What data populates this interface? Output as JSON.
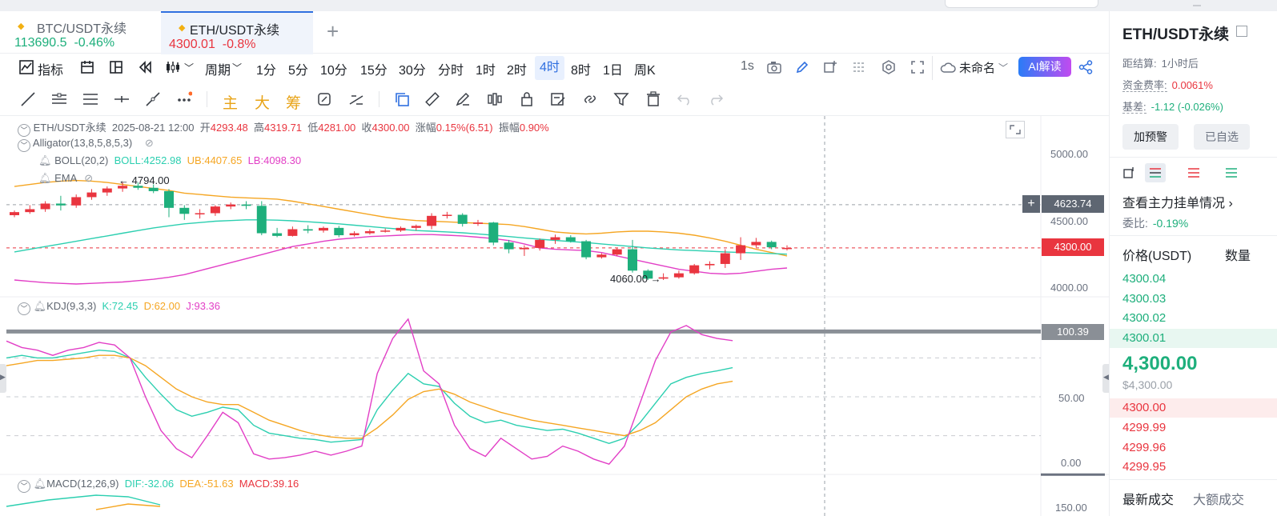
{
  "tabs": [
    {
      "symbol": "BTC/USDT永续",
      "price": "113690.5",
      "change": "-0.46%"
    },
    {
      "symbol": "ETH/USDT永续",
      "price": "4300.01",
      "change": "-0.8%"
    }
  ],
  "toolbar": {
    "indicators": "指标",
    "period": "周期",
    "intervals": [
      "1分",
      "5分",
      "10分",
      "15分",
      "30分",
      "分时",
      "1时",
      "2时",
      "4时",
      "8时",
      "1日",
      "周K"
    ],
    "selected_interval": "4时",
    "refresh": "1s",
    "layout_name": "未命名",
    "ai": "AI解读"
  },
  "drawing_tools": {
    "main": "主",
    "big": "大",
    "chips": "筹"
  },
  "legend": {
    "symbol": "ETH/USDT永续",
    "time": "2025-08-21 12:00",
    "open_label": "开",
    "open": "4293.48",
    "high_label": "高",
    "high": "4319.71",
    "low_label": "低",
    "low": "4281.00",
    "close_label": "收",
    "close": "4300.00",
    "change_label": "涨幅",
    "change": "0.15%(6.51)",
    "amp_label": "振幅",
    "amp": "0.90%",
    "alligator": "Alligator(13,8,5,8,5,3)",
    "boll": "BOLL(20,2)",
    "boll_mid": "BOLL:4252.98",
    "boll_ub": "UB:4407.65",
    "boll_lb": "LB:4098.30",
    "ema": "EMA",
    "kdj": "KDJ(9,3,3)",
    "kdj_k": "K:72.45",
    "kdj_d": "D:62.00",
    "kdj_j": "J:93.36",
    "macd": "MACD(12,26,9)",
    "macd_dif": "DIF:-32.06",
    "macd_dea": "DEA:-51.63",
    "macd_val": "MACD:39.16"
  },
  "price_axis": {
    "ticks": [
      "5000.00",
      "4500.00",
      "4000.00"
    ],
    "crosshair": "4623.74",
    "last": "4300.00",
    "high_marker": "4794.00",
    "low_marker": "4060.00"
  },
  "kdj_axis": {
    "ticks": [
      "50.00",
      "0.00"
    ],
    "crosshair": "100.39"
  },
  "macd_axis": {
    "ticks": [
      "150.00"
    ]
  },
  "colors": {
    "up": "#1eaf7c",
    "down": "#e9353f",
    "accent": "#3070e0",
    "ub": "#f5a623",
    "mid": "#2ccfb0",
    "lb": "#e23fc6"
  },
  "chart_data": {
    "type": "candlestick",
    "title": "ETH/USDT永续",
    "interval": "4时",
    "candles": [
      {
        "o": 4545,
        "h": 4580,
        "l": 4530,
        "c": 4568
      },
      {
        "o": 4568,
        "h": 4620,
        "l": 4555,
        "c": 4590
      },
      {
        "o": 4590,
        "h": 4650,
        "l": 4570,
        "c": 4632
      },
      {
        "o": 4632,
        "h": 4690,
        "l": 4580,
        "c": 4618
      },
      {
        "o": 4618,
        "h": 4700,
        "l": 4600,
        "c": 4680
      },
      {
        "o": 4680,
        "h": 4740,
        "l": 4660,
        "c": 4715
      },
      {
        "o": 4715,
        "h": 4760,
        "l": 4690,
        "c": 4745
      },
      {
        "o": 4745,
        "h": 4794,
        "l": 4720,
        "c": 4765
      },
      {
        "o": 4765,
        "h": 4790,
        "l": 4735,
        "c": 4750
      },
      {
        "o": 4750,
        "h": 4775,
        "l": 4710,
        "c": 4725
      },
      {
        "o": 4725,
        "h": 4740,
        "l": 4530,
        "c": 4600
      },
      {
        "o": 4600,
        "h": 4620,
        "l": 4510,
        "c": 4555
      },
      {
        "o": 4555,
        "h": 4590,
        "l": 4520,
        "c": 4560
      },
      {
        "o": 4560,
        "h": 4620,
        "l": 4540,
        "c": 4610
      },
      {
        "o": 4610,
        "h": 4640,
        "l": 4590,
        "c": 4625
      },
      {
        "o": 4625,
        "h": 4650,
        "l": 4590,
        "c": 4615
      },
      {
        "o": 4615,
        "h": 4650,
        "l": 4395,
        "c": 4410
      },
      {
        "o": 4410,
        "h": 4450,
        "l": 4380,
        "c": 4390
      },
      {
        "o": 4390,
        "h": 4460,
        "l": 4385,
        "c": 4440
      },
      {
        "o": 4440,
        "h": 4470,
        "l": 4410,
        "c": 4430
      },
      {
        "o": 4430,
        "h": 4460,
        "l": 4415,
        "c": 4450
      },
      {
        "o": 4450,
        "h": 4465,
        "l": 4380,
        "c": 4395
      },
      {
        "o": 4395,
        "h": 4425,
        "l": 4385,
        "c": 4410
      },
      {
        "o": 4410,
        "h": 4440,
        "l": 4400,
        "c": 4425
      },
      {
        "o": 4425,
        "h": 4445,
        "l": 4415,
        "c": 4430
      },
      {
        "o": 4430,
        "h": 4460,
        "l": 4420,
        "c": 4450
      },
      {
        "o": 4450,
        "h": 4475,
        "l": 4430,
        "c": 4465
      },
      {
        "o": 4465,
        "h": 4560,
        "l": 4440,
        "c": 4540
      },
      {
        "o": 4540,
        "h": 4570,
        "l": 4520,
        "c": 4548
      },
      {
        "o": 4548,
        "h": 4560,
        "l": 4460,
        "c": 4480
      },
      {
        "o": 4480,
        "h": 4510,
        "l": 4465,
        "c": 4490
      },
      {
        "o": 4490,
        "h": 4495,
        "l": 4320,
        "c": 4340
      },
      {
        "o": 4340,
        "h": 4360,
        "l": 4260,
        "c": 4290
      },
      {
        "o": 4290,
        "h": 4320,
        "l": 4240,
        "c": 4300
      },
      {
        "o": 4300,
        "h": 4370,
        "l": 4280,
        "c": 4360
      },
      {
        "o": 4360,
        "h": 4400,
        "l": 4330,
        "c": 4380
      },
      {
        "o": 4380,
        "h": 4395,
        "l": 4340,
        "c": 4350
      },
      {
        "o": 4350,
        "h": 4360,
        "l": 4215,
        "c": 4230
      },
      {
        "o": 4230,
        "h": 4260,
        "l": 4220,
        "c": 4250
      },
      {
        "o": 4250,
        "h": 4300,
        "l": 4240,
        "c": 4290
      },
      {
        "o": 4290,
        "h": 4360,
        "l": 4115,
        "c": 4130
      },
      {
        "o": 4130,
        "h": 4140,
        "l": 4060,
        "c": 4070
      },
      {
        "o": 4070,
        "h": 4110,
        "l": 4060,
        "c": 4080
      },
      {
        "o": 4080,
        "h": 4130,
        "l": 4070,
        "c": 4110
      },
      {
        "o": 4110,
        "h": 4180,
        "l": 4100,
        "c": 4170
      },
      {
        "o": 4170,
        "h": 4200,
        "l": 4140,
        "c": 4180
      },
      {
        "o": 4180,
        "h": 4290,
        "l": 4150,
        "c": 4260
      },
      {
        "o": 4260,
        "h": 4380,
        "l": 4210,
        "c": 4320
      },
      {
        "o": 4320,
        "h": 4375,
        "l": 4305,
        "c": 4345
      },
      {
        "o": 4345,
        "h": 4355,
        "l": 4290,
        "c": 4305
      },
      {
        "o": 4293.48,
        "h": 4319.71,
        "l": 4281.0,
        "c": 4300.0
      }
    ],
    "boll_ub": [
      4760,
      4775,
      4790,
      4800,
      4805,
      4800,
      4790,
      4775,
      4760,
      4745,
      4730,
      4710,
      4700,
      4690,
      4680,
      4675,
      4670,
      4665,
      4650,
      4630,
      4610,
      4590,
      4570,
      4550,
      4530,
      4515,
      4505,
      4500,
      4495,
      4490,
      4485,
      4480,
      4475,
      4460,
      4440,
      4420,
      4410,
      4405,
      4410,
      4420,
      4425,
      4425,
      4420,
      4410,
      4395,
      4375,
      4350,
      4320,
      4290,
      4265,
      4240
    ],
    "boll_mid": [
      4270,
      4290,
      4310,
      4330,
      4350,
      4370,
      4390,
      4410,
      4430,
      4450,
      4465,
      4480,
      4490,
      4500,
      4505,
      4510,
      4510,
      4508,
      4503,
      4496,
      4488,
      4480,
      4470,
      4460,
      4450,
      4440,
      4430,
      4425,
      4420,
      4413,
      4405,
      4395,
      4385,
      4375,
      4365,
      4356,
      4348,
      4340,
      4330,
      4320,
      4310,
      4300,
      4292,
      4285,
      4280,
      4275,
      4270,
      4266,
      4262,
      4258,
      4253
    ],
    "boll_lb": [
      4060,
      4050,
      4040,
      4035,
      4030,
      4035,
      4040,
      4045,
      4055,
      4065,
      4080,
      4100,
      4130,
      4160,
      4190,
      4220,
      4250,
      4280,
      4310,
      4330,
      4350,
      4365,
      4375,
      4385,
      4390,
      4395,
      4400,
      4400,
      4395,
      4390,
      4380,
      4370,
      4355,
      4330,
      4300,
      4290,
      4285,
      4280,
      4265,
      4240,
      4215,
      4190,
      4165,
      4140,
      4125,
      4110,
      4105,
      4110,
      4125,
      4140,
      4150
    ],
    "kdj_k": [
      80,
      82,
      80,
      80,
      82,
      84,
      86,
      85,
      80,
      65,
      52,
      40,
      35,
      38,
      42,
      40,
      28,
      22,
      20,
      18,
      17,
      15,
      16,
      17,
      40,
      55,
      68,
      60,
      58,
      45,
      35,
      30,
      32,
      28,
      26,
      24,
      25,
      22,
      18,
      14,
      18,
      30,
      45,
      60,
      65,
      68,
      70,
      72.45
    ],
    "kdj_d": [
      74,
      76,
      78,
      78,
      79,
      80,
      82,
      82,
      80,
      74,
      65,
      56,
      50,
      46,
      44,
      44,
      38,
      32,
      28,
      24,
      21,
      19,
      18,
      18,
      26,
      36,
      48,
      54,
      56,
      52,
      46,
      42,
      38,
      35,
      32,
      30,
      28,
      26,
      24,
      22,
      20,
      24,
      30,
      40,
      50,
      56,
      60,
      62
    ],
    "kdj_j": [
      93,
      88,
      86,
      82,
      86,
      88,
      92,
      90,
      80,
      50,
      24,
      10,
      3,
      20,
      38,
      30,
      6,
      2,
      3,
      5,
      8,
      5,
      8,
      12,
      68,
      95,
      110,
      70,
      60,
      28,
      10,
      4,
      18,
      10,
      2,
      4,
      12,
      8,
      2,
      -2,
      12,
      45,
      78,
      100,
      105,
      98,
      95,
      93.36
    ],
    "macd_axis_ticks": [
      150
    ]
  }
}
